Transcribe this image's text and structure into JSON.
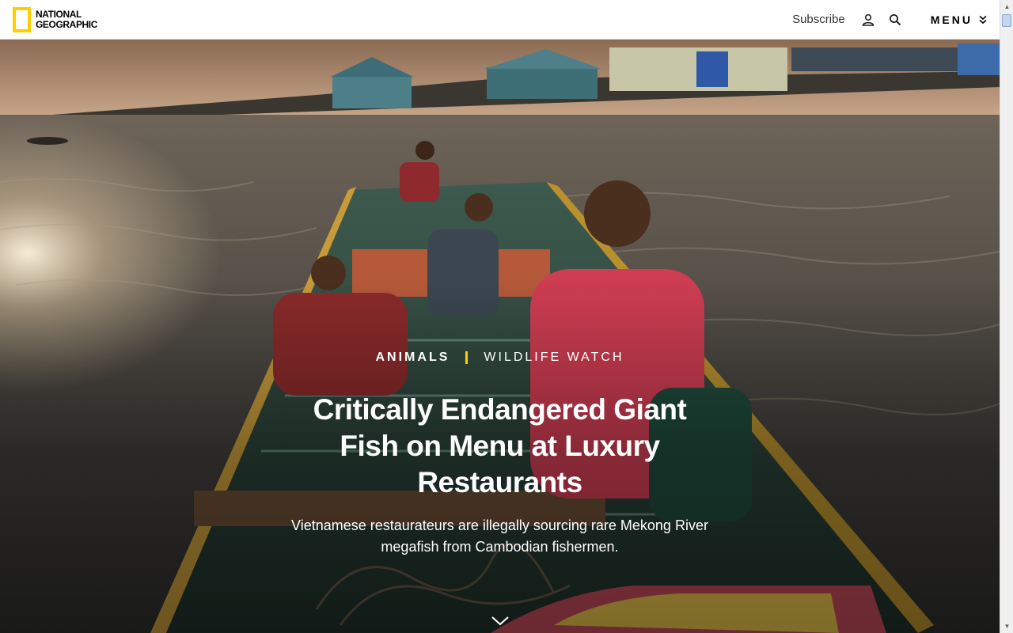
{
  "header": {
    "logo_line1": "NATIONAL",
    "logo_line2": "GEOGRAPHIC",
    "subscribe_label": "Subscribe",
    "menu_label": "MENU",
    "brand_color": "#ffce00"
  },
  "hero": {
    "category_primary": "Animals",
    "category_secondary": "Wildlife Watch",
    "headline": "Critically Endangered Giant Fish on Menu at Luxury Restaurants",
    "dek": "Vietnamese restaurateurs are illegally sourcing rare Mekong River megafish from Cambodian fishermen."
  },
  "icons": {
    "user": "user-icon",
    "search": "search-icon",
    "menu_chevron": "chevron-double-down-icon",
    "scroll_down": "chevron-down-icon"
  }
}
